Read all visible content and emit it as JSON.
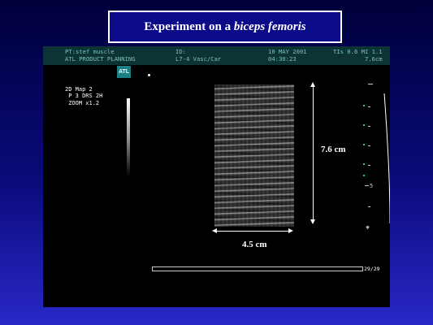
{
  "slide": {
    "title_plain": "Experiment on a ",
    "title_italic": "biceps femoris"
  },
  "header": {
    "patient": "PT:stef muscle",
    "org": "ATL PRODUCT PLANNING",
    "id_label": "ID:",
    "probe": "L7-4 Vasc/Car",
    "date": "10 MAY 2001",
    "time": "04:30:23",
    "indices": "TIs 0.6 MI 1.1",
    "depth": "7.6cm"
  },
  "logo": {
    "text": "ATL"
  },
  "params": {
    "lines": [
      "2D Map 2",
      " P 3 DRS 2H",
      " ZOOM x1.2"
    ]
  },
  "measurements": {
    "vertical_label": "7.6 cm",
    "horizontal_label": "4.5 cm"
  },
  "depth_scale": {
    "mark": "5"
  },
  "cine": {
    "label": "29/29",
    "progress": 1.0
  },
  "colors": {
    "title_box": "#0b0b8a",
    "header_bg": "#0c3434",
    "header_text": "#7fbfbf",
    "scale_dots": "#2fd07a"
  },
  "icons": {
    "focus": "focus-crosshair-icon",
    "logo": "atl-logo-icon"
  }
}
